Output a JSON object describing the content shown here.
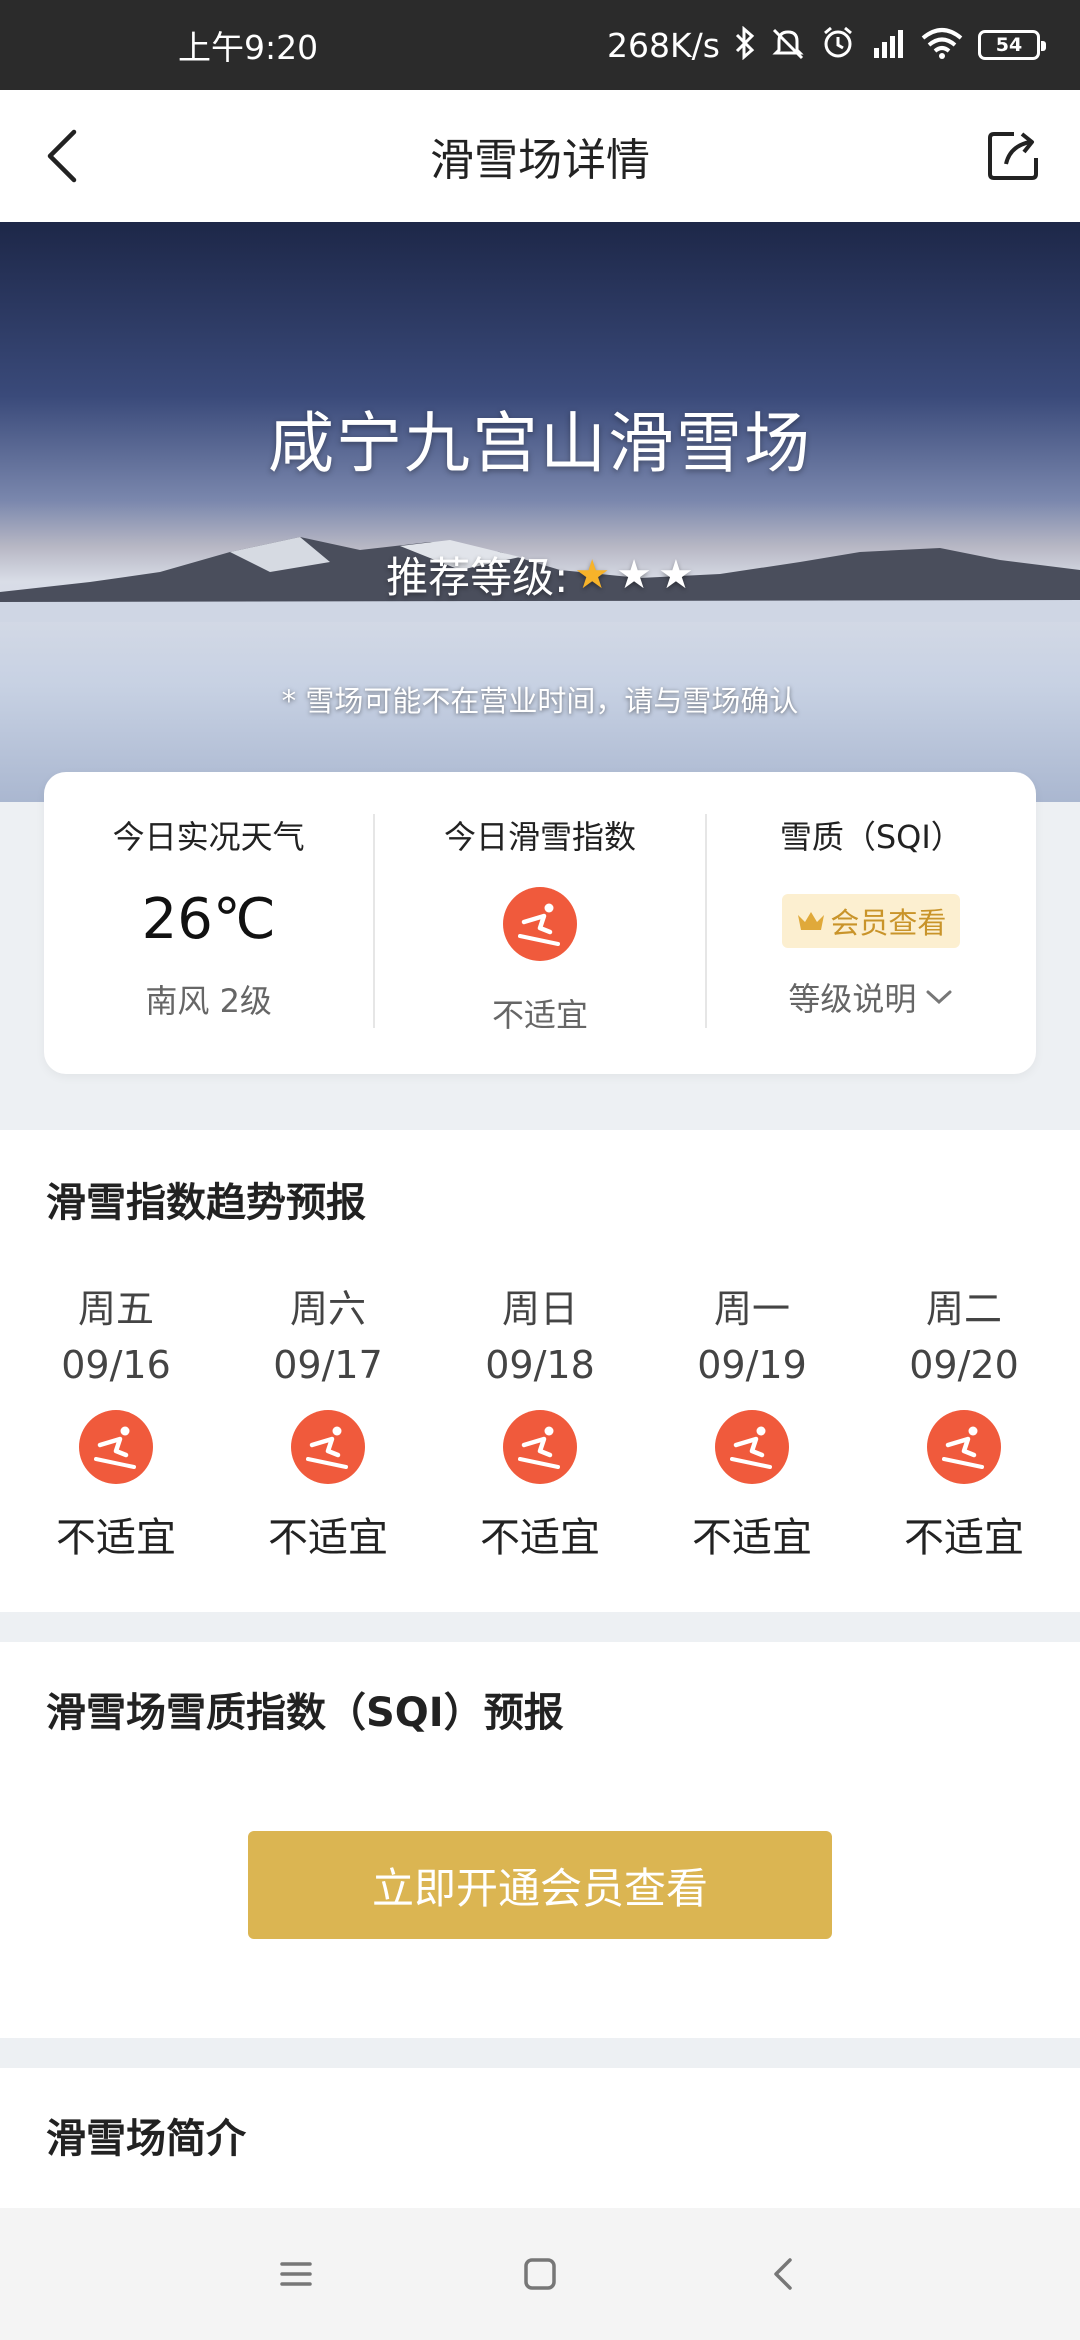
{
  "status_bar": {
    "time": "上午9:20",
    "network_speed": "268K/s",
    "battery": "54",
    "icons": [
      "bluetooth-icon",
      "mute-icon",
      "alarm-icon",
      "signal-icon",
      "wifi-icon",
      "battery-icon"
    ]
  },
  "nav": {
    "title": "滑雪场详情",
    "back_icon": "back-arrow-icon",
    "share_icon": "share-icon"
  },
  "hero": {
    "resort_name": "咸宁九宫山滑雪场",
    "rating_label": "推荐等级:",
    "rating": 1,
    "rating_max": 3,
    "note": "* 雪场可能不在营业时间，请与雪场确认"
  },
  "summary": {
    "weather_title": "今日实况天气",
    "temperature": "26℃",
    "wind": "南风 2级",
    "ski_index_title": "今日滑雪指数",
    "ski_index_status": "不适宜",
    "sqi_title": "雪质（SQI）",
    "vip_badge": "会员查看",
    "level_desc": "等级说明"
  },
  "trend": {
    "title": "滑雪指数趋势预报",
    "days": [
      {
        "week": "周五",
        "date": "09/16",
        "status": "不适宜"
      },
      {
        "week": "周六",
        "date": "09/17",
        "status": "不适宜"
      },
      {
        "week": "周日",
        "date": "09/18",
        "status": "不适宜"
      },
      {
        "week": "周一",
        "date": "09/19",
        "status": "不适宜"
      },
      {
        "week": "周二",
        "date": "09/20",
        "status": "不适宜"
      }
    ]
  },
  "sqi": {
    "title": "滑雪场雪质指数（SQI）预报",
    "button": "立即开通会员查看"
  },
  "intro": {
    "title": "滑雪场简介"
  },
  "colors": {
    "accent_gold": "#dbb552",
    "ski_icon_red": "#f05a3c",
    "star_gold": "#f7b32a"
  }
}
